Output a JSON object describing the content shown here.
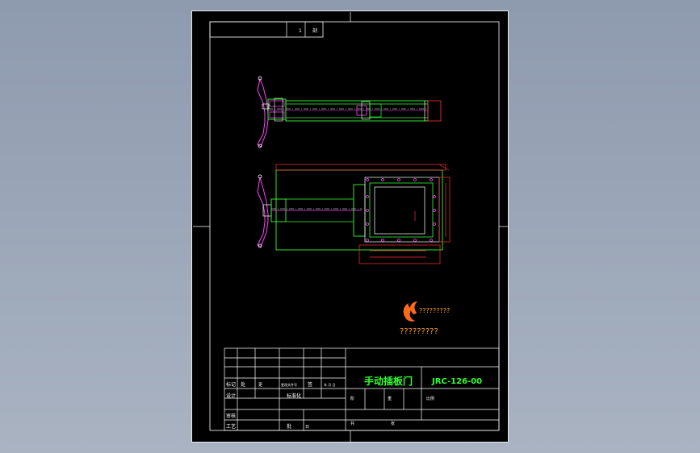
{
  "colors": {
    "background": "#9aa6b8",
    "sheet": "#000000",
    "frame": "#ffffff",
    "outline_green": "#33ff33",
    "dim_red": "#ff3333",
    "part_magenta": "#ff44ff",
    "logo_orange": "#ffa126",
    "title_green": "#33ff33"
  },
  "drawing": {
    "top_block": {
      "num": "1",
      "label": "剖"
    },
    "watermark": {
      "line1": "?????????",
      "line2": "?????????",
      "logo_icon": "flame-logo-icon"
    },
    "title_block": {
      "product_name": "手动插板门",
      "drawing_number": "JRC-126-00",
      "labels": {
        "mark": "标记",
        "count": "处",
        "zone": "更",
        "change_doc": "更改文件号",
        "sign": "签",
        "date": "年 月 日",
        "design": "设计",
        "standardize": "标准化",
        "review": "审核",
        "process": "工艺",
        "approve": "批",
        "date2": "日",
        "stage": "阶",
        "weight": "重",
        "scale": "比例",
        "sheet_total": "共",
        "sheet_num": "张"
      }
    }
  }
}
